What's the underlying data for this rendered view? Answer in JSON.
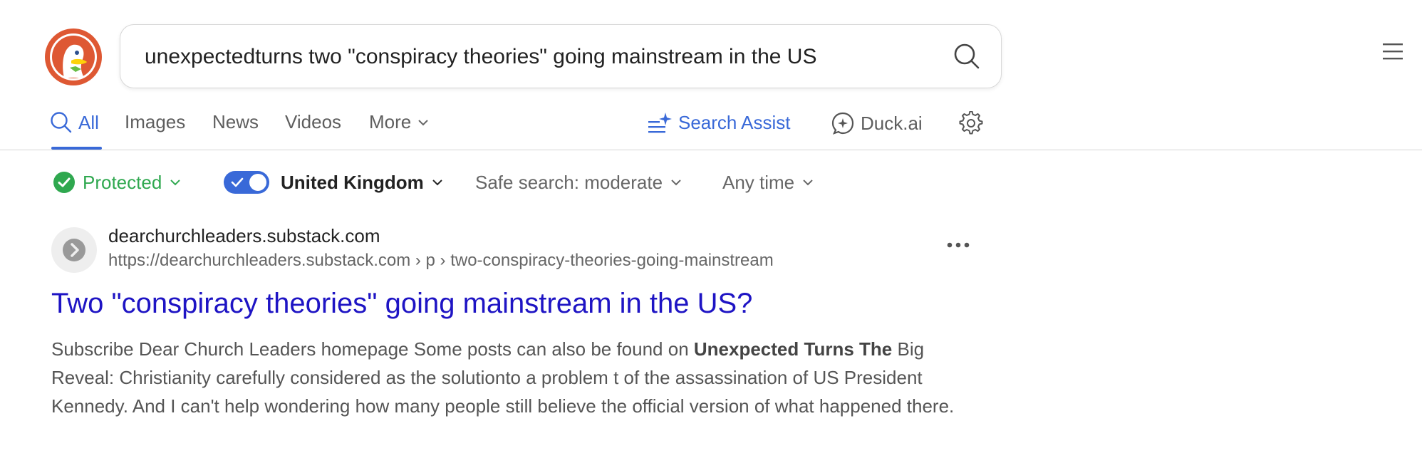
{
  "search": {
    "query": "unexpectedturns two \"conspiracy theories\" going mainstream in the US"
  },
  "tabs": [
    {
      "label": "All",
      "active": true
    },
    {
      "label": "Images"
    },
    {
      "label": "News"
    },
    {
      "label": "Videos"
    },
    {
      "label": "More"
    }
  ],
  "tools": {
    "search_assist": "Search Assist",
    "duck_ai": "Duck.ai"
  },
  "filters": {
    "protected": "Protected",
    "region": "United Kingdom",
    "region_toggle_on": true,
    "safe_search": "Safe search: moderate",
    "time": "Any time"
  },
  "result": {
    "site": "dearchurchleaders.substack.com",
    "url": "https://dearchurchleaders.substack.com › p › two-conspiracy-theories-going-mainstream",
    "title": "Two \"conspiracy theories\" going mainstream in the US?",
    "snippet_a": "Subscribe Dear Church Leaders homepage Some posts can also be found on ",
    "snippet_bold": "Unexpected Turns The",
    "snippet_b": " Big Reveal: Christianity carefully considered as the solutionto a problem t of the assassination of US President Kennedy. And I can't help wondering how many people still believe the official version of what happened there."
  },
  "colors": {
    "accent": "#3969d8",
    "title_link": "#1e14c4",
    "protected_green": "#2fa84f",
    "brand_orange": "#de5833"
  }
}
